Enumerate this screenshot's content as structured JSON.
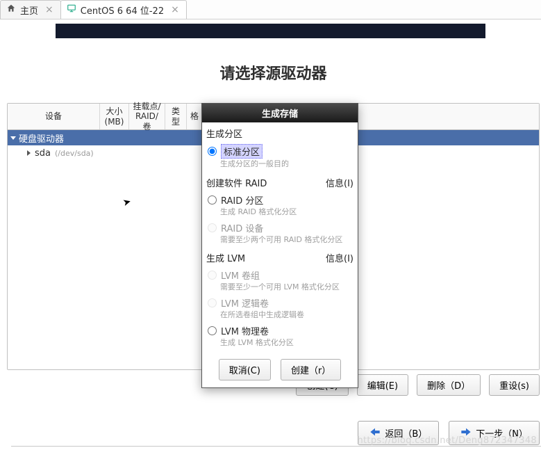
{
  "tabs": {
    "home": "主页",
    "vm": "CentOS 6 64 位-22"
  },
  "page_title": "请选择源驱动器",
  "table": {
    "headers": {
      "device": "设备",
      "size": "大小\n(MB)",
      "mount": "挂载点/\nRAID/卷",
      "type": "类型",
      "format": "格"
    },
    "group": "硬盘驱动器",
    "device_name": "sda",
    "device_path": "(/dev/sda)"
  },
  "buttons": {
    "create": "创建(C)",
    "edit": "编辑(E)",
    "delete": "删除（D）",
    "reset": "重设(s)",
    "back": "返回（B）",
    "next": "下一步（N）"
  },
  "dialog": {
    "title": "生成存储",
    "section_partition": "生成分区",
    "opt_standard": "标准分区",
    "sub_standard": "生成分区的一般目的",
    "section_raid": "创建软件 RAID",
    "info": "信息(I)",
    "opt_raid_part": "RAID 分区",
    "sub_raid_part": "生成 RAID 格式化分区",
    "opt_raid_dev": "RAID 设备",
    "sub_raid_dev": "需要至少两个可用 RAID 格式化分区",
    "section_lvm": "生成 LVM",
    "opt_lvm_vg": "LVM 卷组",
    "sub_lvm_vg": "需要至少一个可用 LVM 格式化分区",
    "opt_lvm_lv": "LVM 逻辑卷",
    "sub_lvm_lv": "在所选卷组中生成逻辑卷",
    "opt_lvm_pv": "LVM 物理卷",
    "sub_lvm_pv": "生成 LVM 格式化分区",
    "cancel": "取消(C)",
    "create": "创建（r）"
  },
  "watermark": "https://blog.csdn.net/Deng872347348"
}
